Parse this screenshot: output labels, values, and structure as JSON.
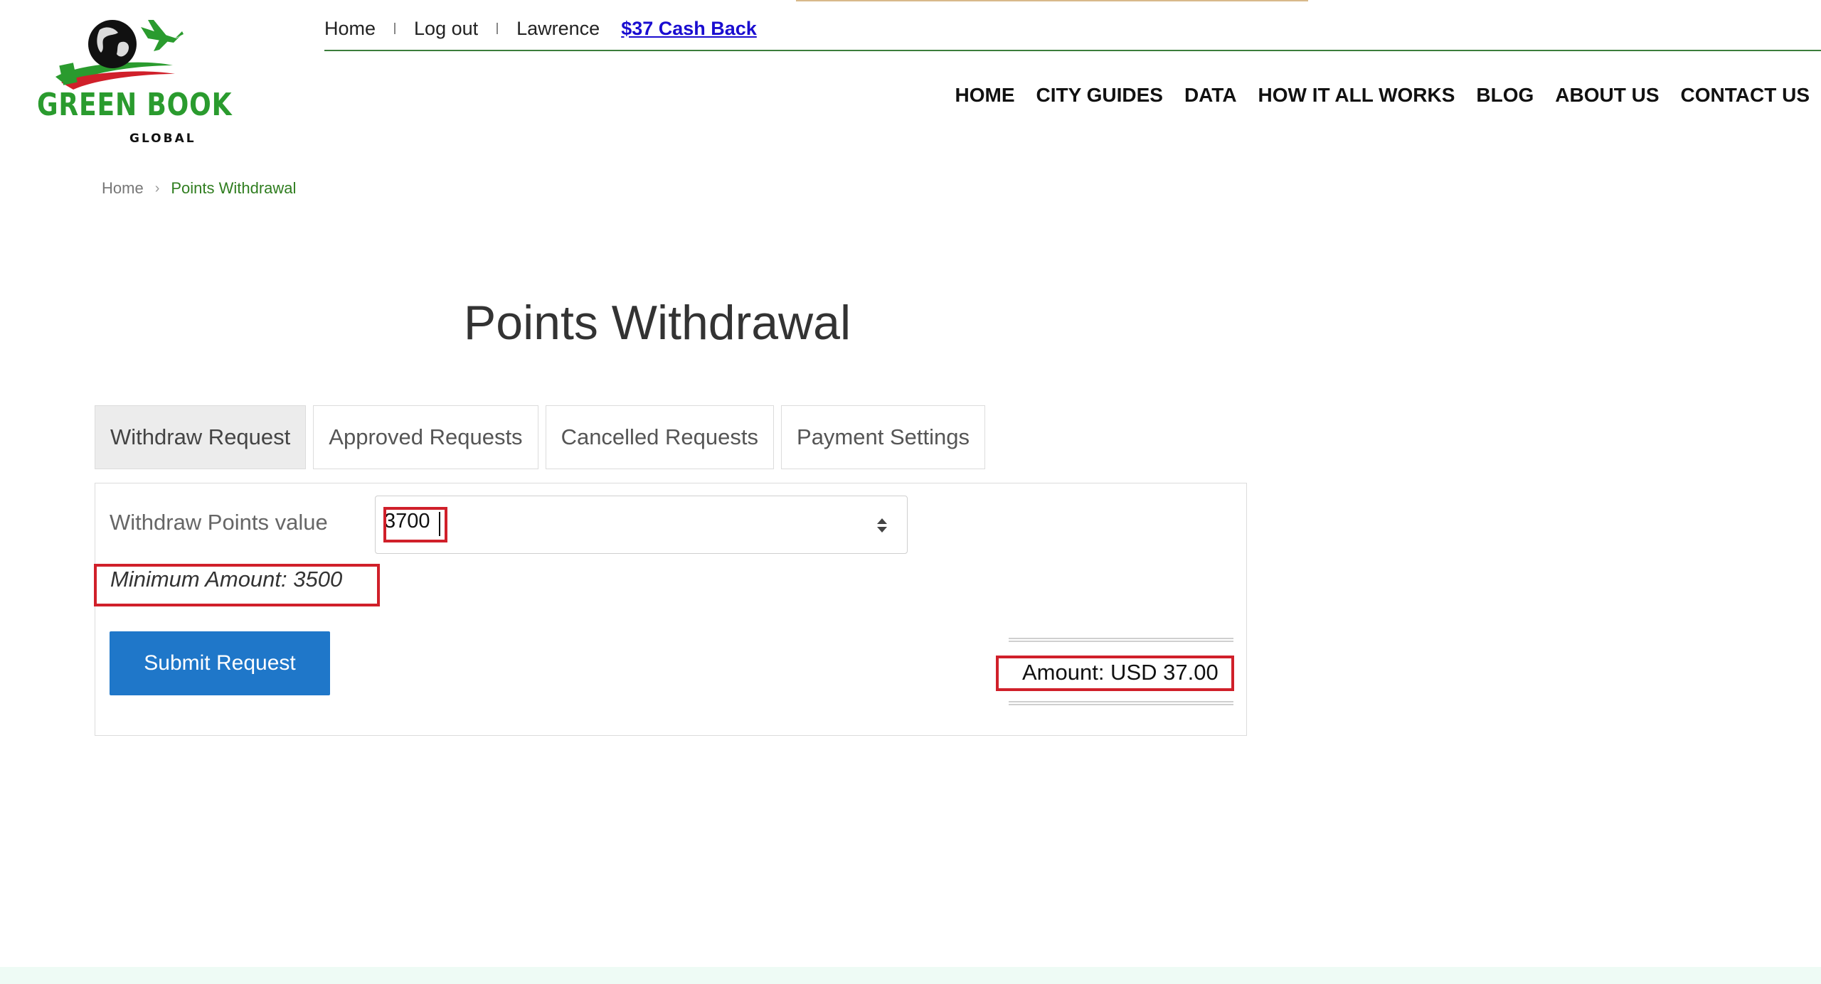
{
  "logo": {
    "name": "GREEN BOOK",
    "tagline": "GLOBAL",
    "colors": {
      "green": "#2a9b2e",
      "red": "#d0202a"
    }
  },
  "util_nav": {
    "home": "Home",
    "logout": "Log out",
    "user": "Lawrence",
    "cashback": "$37 Cash Back"
  },
  "main_nav": [
    "HOME",
    "CITY GUIDES",
    "DATA",
    "HOW IT ALL WORKS",
    "BLOG",
    "ABOUT US",
    "CONTACT US"
  ],
  "breadcrumb": {
    "home": "Home",
    "current": "Points Withdrawal"
  },
  "page": {
    "title": "Points Withdrawal"
  },
  "tabs": [
    "Withdraw Request",
    "Approved Requests",
    "Cancelled Requests",
    "Payment Settings"
  ],
  "form": {
    "points_label": "Withdraw Points value",
    "points_value": "3700",
    "minimum_text": "Minimum Amount: 3500",
    "submit_label": "Submit Request",
    "amount_text": "Amount: USD 37.00"
  },
  "colors": {
    "accent_blue": "#1f77c9",
    "highlight_red": "#d0202a",
    "link_blue": "#1a0dd0",
    "breadcrumb_green": "#2f7d1f"
  }
}
